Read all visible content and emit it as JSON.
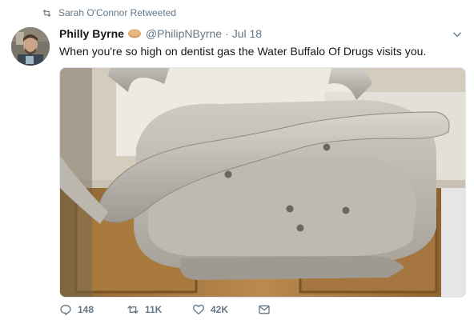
{
  "retweet_notice": "Sarah O'Connor Retweeted",
  "tweet": {
    "author_name": "Philly Byrne",
    "author_emoji": "bread-emoji",
    "handle": "@PhilipNByrne",
    "separator": "·",
    "date": "Jul 18",
    "text": "When you're so high on dentist gas the Water Buffalo Of Drugs visits you."
  },
  "media": {
    "subject": "dental-lamp-photo"
  },
  "actions": {
    "replies": "148",
    "retweets": "11K",
    "likes": "42K"
  },
  "icons": {
    "retweet": "retweet-icon",
    "reply": "reply-icon",
    "like": "heart-icon",
    "dm": "envelope-icon",
    "menu": "chevron-down-icon"
  },
  "colors": {
    "muted": "#657786",
    "text": "#14171a",
    "border": "#e1e8ed"
  }
}
